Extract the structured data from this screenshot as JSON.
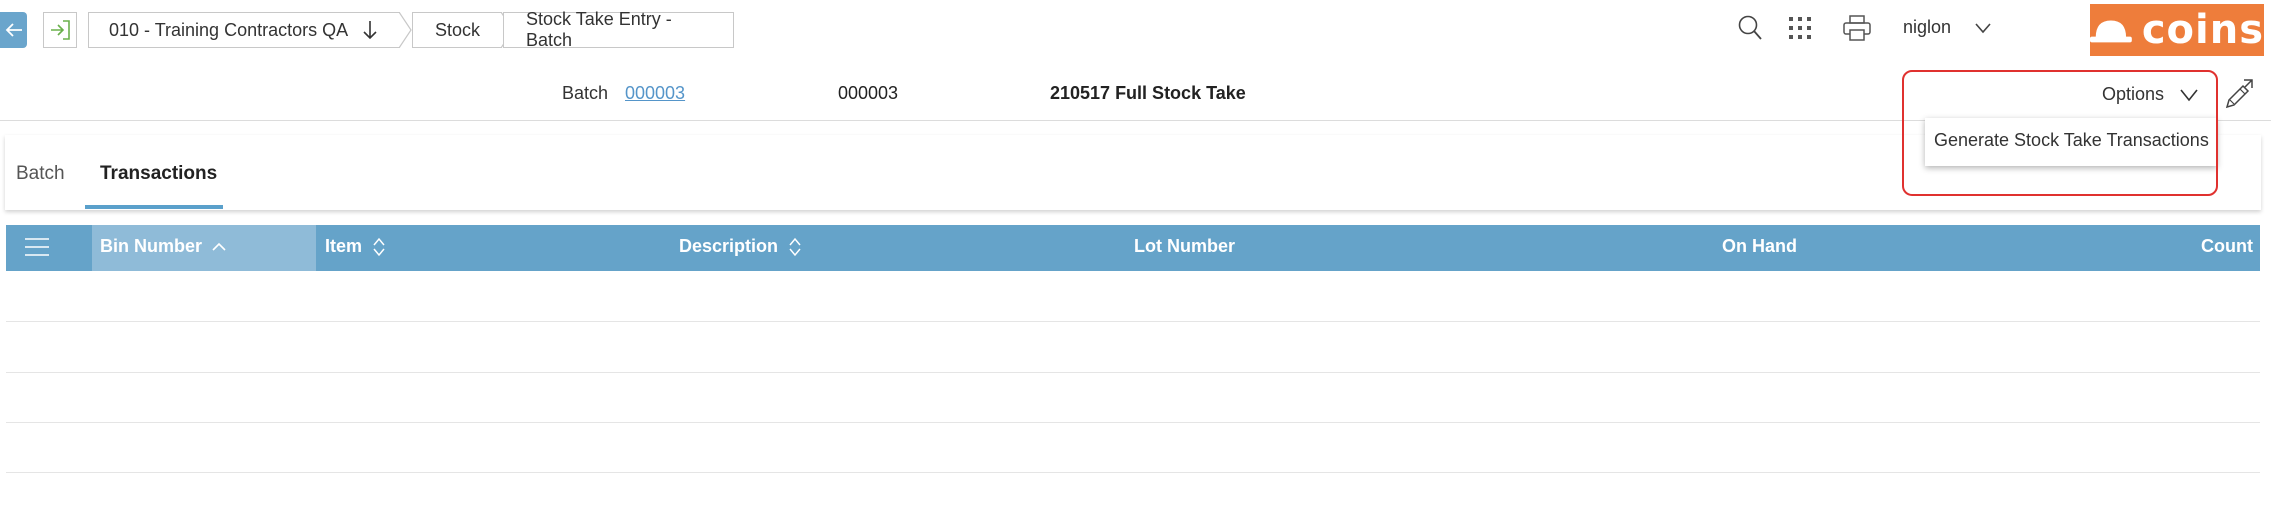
{
  "breadcrumbs": [
    "010 - Training Contractors QA",
    "Stock",
    "Stock Take Entry - Batch"
  ],
  "user": {
    "name": "niglon"
  },
  "brand": {
    "logo_text": "coins",
    "color": "#ee7d3b"
  },
  "header": {
    "batch_label": "Batch",
    "batch_link": "000003",
    "batch_code": "000003",
    "batch_description": "210517 Full Stock Take",
    "options_label": "Options"
  },
  "options_menu": {
    "items": [
      "Generate Stock Take Transactions"
    ]
  },
  "tabs": [
    {
      "label": "Batch",
      "active": false
    },
    {
      "label": "Transactions",
      "active": true
    }
  ],
  "grid": {
    "header_color": "#65a3c9",
    "columns": [
      "Bin Number",
      "Item",
      "Description",
      "Lot Number",
      "On Hand",
      "Count"
    ],
    "sorted_column": "Bin Number",
    "sort_direction": "ascending",
    "rows": []
  },
  "icons": [
    "back-arrow-icon",
    "exit-icon",
    "arrow-down-icon",
    "search-icon",
    "apps-grid-icon",
    "printer-icon",
    "chevron-down-icon",
    "hard-hat-icon",
    "edit-icon",
    "menu-lines-icon",
    "sort-up-icon",
    "sort-both-icon"
  ]
}
